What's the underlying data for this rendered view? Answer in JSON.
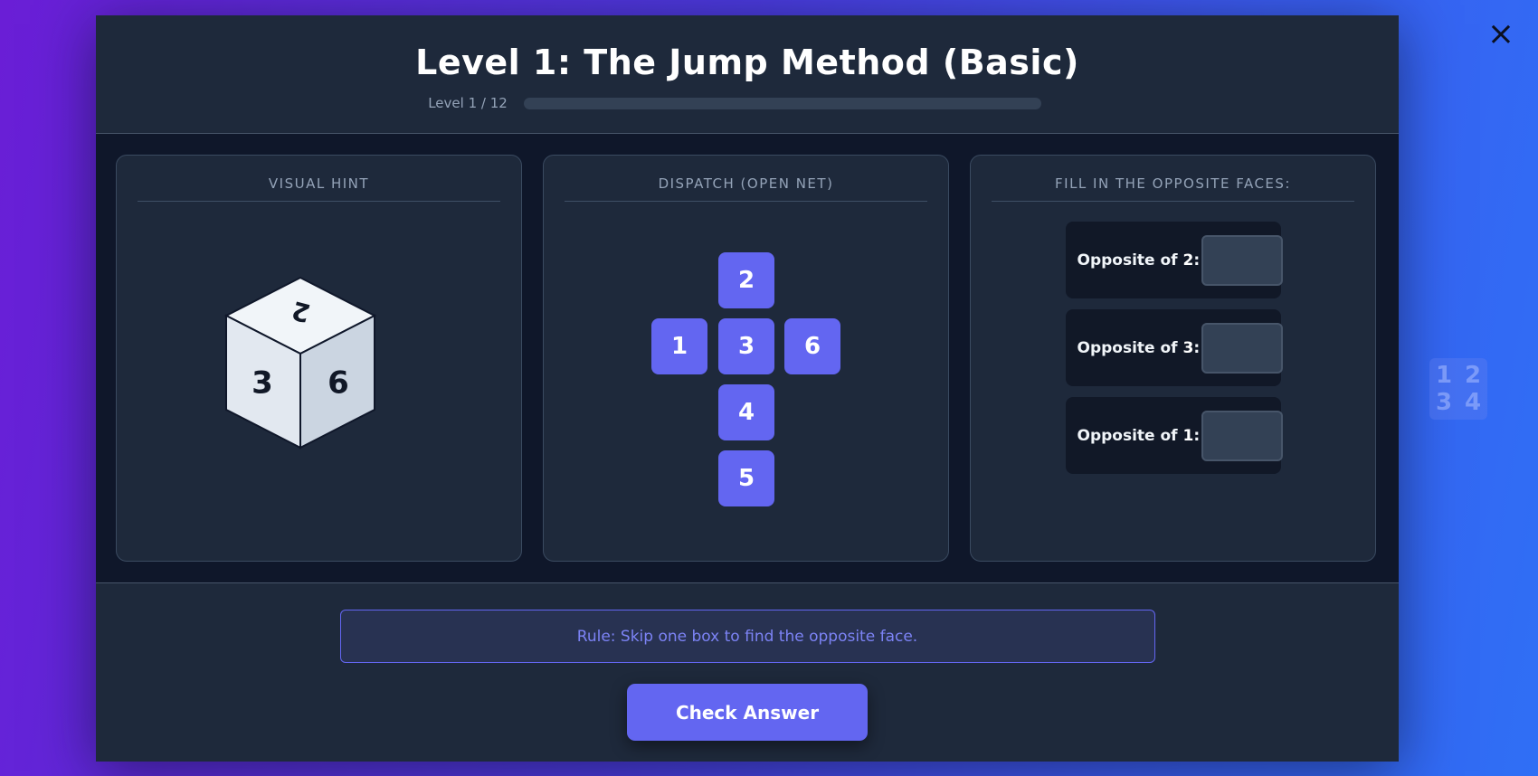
{
  "header": {
    "title": "Level 1: The Jump Method (Basic)",
    "progress_label": "Level 1 / 12",
    "progress_fraction": 0
  },
  "panels": {
    "visual_hint_title": "VISUAL HINT",
    "net_title": "DISPATCH (OPEN NET)",
    "answers_title": "FILL IN THE OPPOSITE FACES:"
  },
  "cube": {
    "top": "2",
    "left": "3",
    "right": "6"
  },
  "net": {
    "cells": [
      "2",
      "1",
      "3",
      "6",
      "4",
      "5"
    ]
  },
  "answers": [
    {
      "prefix": "Opposite of ",
      "number": "2",
      "suffix": ":",
      "value": ""
    },
    {
      "prefix": "Opposite of ",
      "number": "3",
      "suffix": ":",
      "value": ""
    },
    {
      "prefix": "Opposite of ",
      "number": "1",
      "suffix": ":",
      "value": ""
    }
  ],
  "footer": {
    "rule": "Rule: Skip one box to find the opposite face.",
    "check_label": "Check Answer"
  },
  "close_icon": "×",
  "side_widget": {
    "icon": "numbers-grid-icon",
    "digits": [
      "1",
      "2",
      "3",
      "4"
    ]
  },
  "colors": {
    "accent": "#6366f1",
    "panel_bg": "#1e293b",
    "main_bg": "#0f172a"
  }
}
